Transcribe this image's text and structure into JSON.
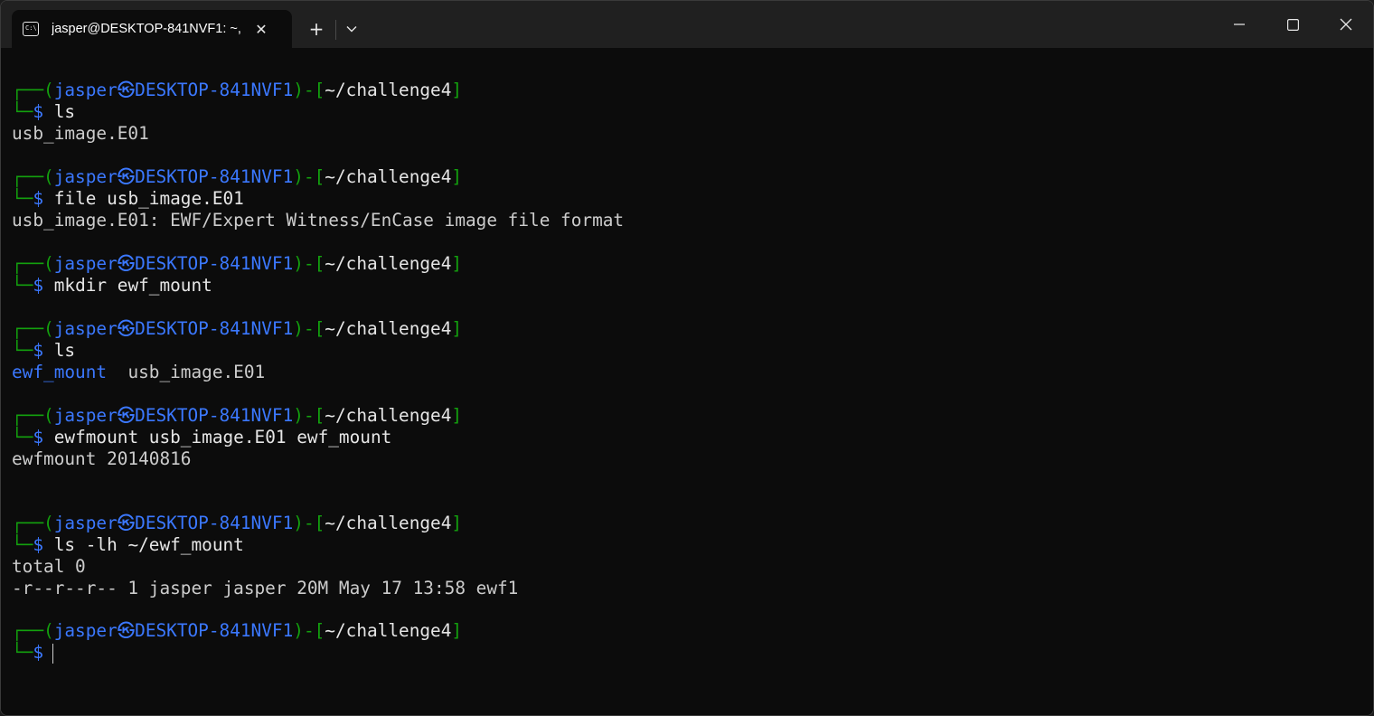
{
  "window": {
    "tab_title": "jasper@DESKTOP-841NVF1: ~,",
    "tab_icon": "terminal-icon",
    "new_tab_label": "+",
    "close_tab_glyph": "✕"
  },
  "prompt": {
    "user": "jasper",
    "host": "DESKTOP-841NVF1",
    "dir": "~/challenge4",
    "symbol": "$"
  },
  "terminal": {
    "blocks": [
      {
        "command": "ls",
        "output": [
          "usb_image.E01"
        ]
      },
      {
        "command": "file usb_image.E01",
        "output": [
          "usb_image.E01: EWF/Expert Witness/EnCase image file format"
        ]
      },
      {
        "command": "mkdir ewf_mount",
        "output": []
      },
      {
        "command": "ls",
        "output_dir": "ewf_mount",
        "output_file": "usb_image.E01"
      },
      {
        "command": "ewfmount usb_image.E01 ewf_mount",
        "output": [
          "ewfmount 20140816"
        ]
      },
      {
        "command": "ls -lh ~/ewf_mount",
        "output": [
          "total 0",
          "-r--r--r-- 1 jasper jasper 20M May 17 13:58 ewf1"
        ]
      },
      {
        "command": "",
        "output": []
      }
    ]
  },
  "colors": {
    "background": "#0c0c0c",
    "prompt_green": "#13a10e",
    "prompt_blue": "#3b78ff",
    "text": "#cccccc"
  }
}
